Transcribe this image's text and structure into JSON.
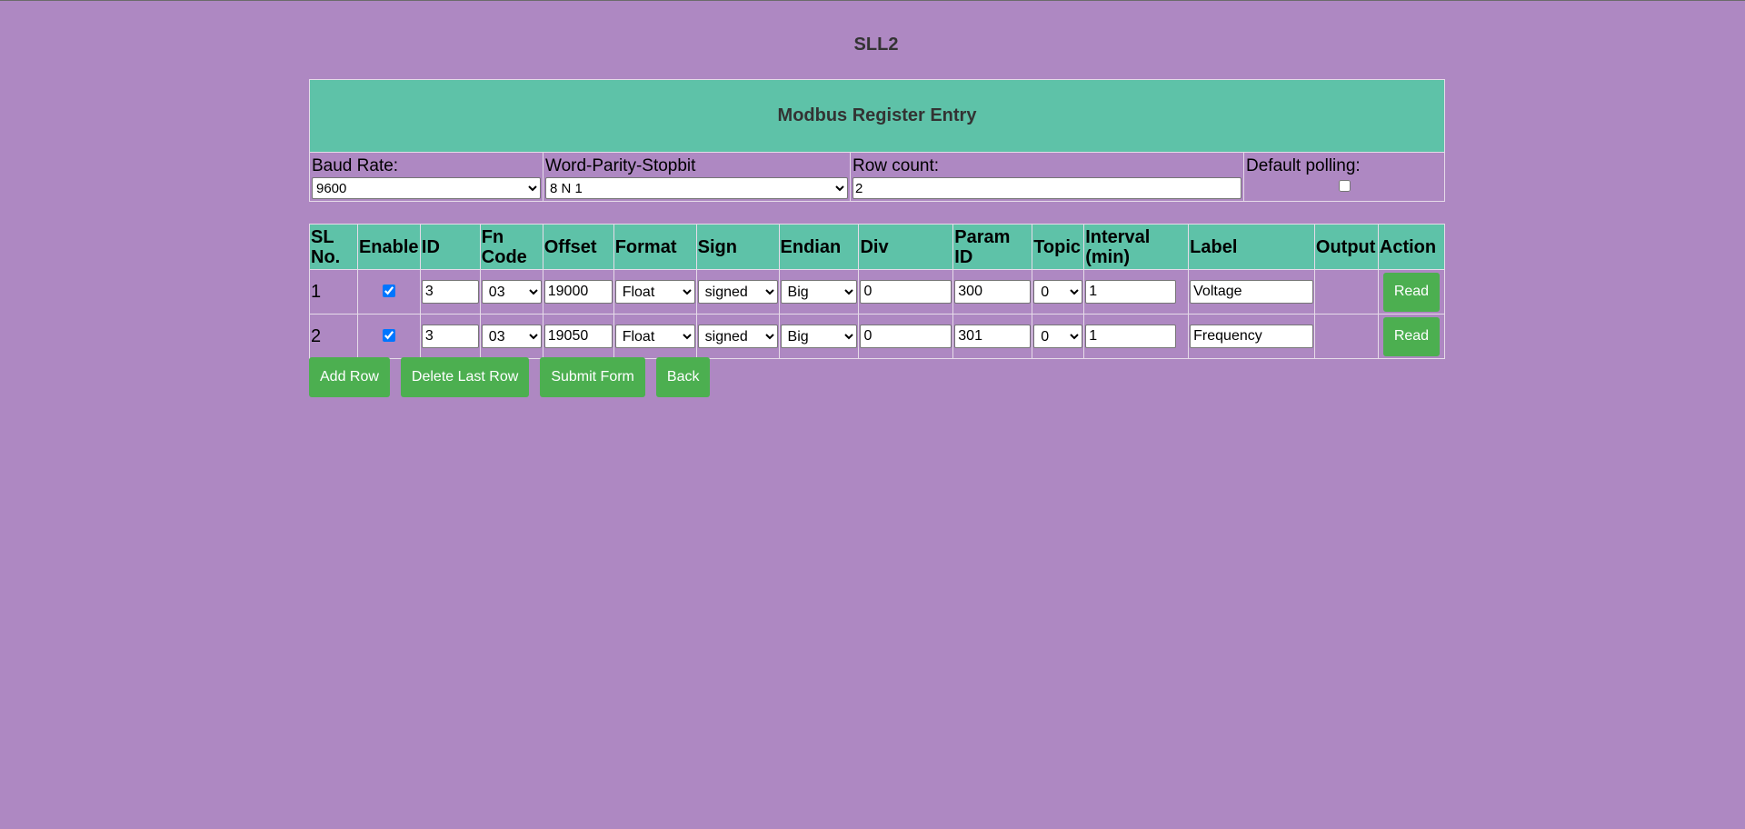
{
  "page": {
    "title": "SLL2"
  },
  "settings": {
    "header": "Modbus Register Entry",
    "baud_rate": {
      "label": "Baud Rate:",
      "value": "9600"
    },
    "word_parity_stopbit": {
      "label": "Word-Parity-Stopbit",
      "value": "8 N 1"
    },
    "row_count": {
      "label": "Row count:",
      "value": "2"
    },
    "default_polling": {
      "label": "Default polling:",
      "checked": false
    }
  },
  "table": {
    "columns": [
      "SL No.",
      "Enable",
      "ID",
      "Fn Code",
      "Offset",
      "Format",
      "Sign",
      "Endian",
      "Div",
      "Param ID",
      "Topic",
      "Interval (min)",
      "Label",
      "Output",
      "Action"
    ],
    "rows": [
      {
        "sl": "1",
        "enabled": true,
        "id": "3",
        "fn_code": "03",
        "offset": "19000",
        "format": "Float",
        "sign": "signed",
        "endian": "Big",
        "div": "0",
        "param_id": "300",
        "topic": "0",
        "interval": "1",
        "label": "Voltage",
        "output": "",
        "action": "Read"
      },
      {
        "sl": "2",
        "enabled": true,
        "id": "3",
        "fn_code": "03",
        "offset": "19050",
        "format": "Float",
        "sign": "signed",
        "endian": "Big",
        "div": "0",
        "param_id": "301",
        "topic": "0",
        "interval": "1",
        "label": "Frequency",
        "output": "",
        "action": "Read"
      }
    ]
  },
  "actions": {
    "add_row": "Add Row",
    "delete_last_row": "Delete Last Row",
    "submit_form": "Submit Form",
    "back": "Back"
  },
  "colors": {
    "background": "#ae88c2",
    "header_bg": "#5ec2a8",
    "button_bg": "#4caf50"
  }
}
